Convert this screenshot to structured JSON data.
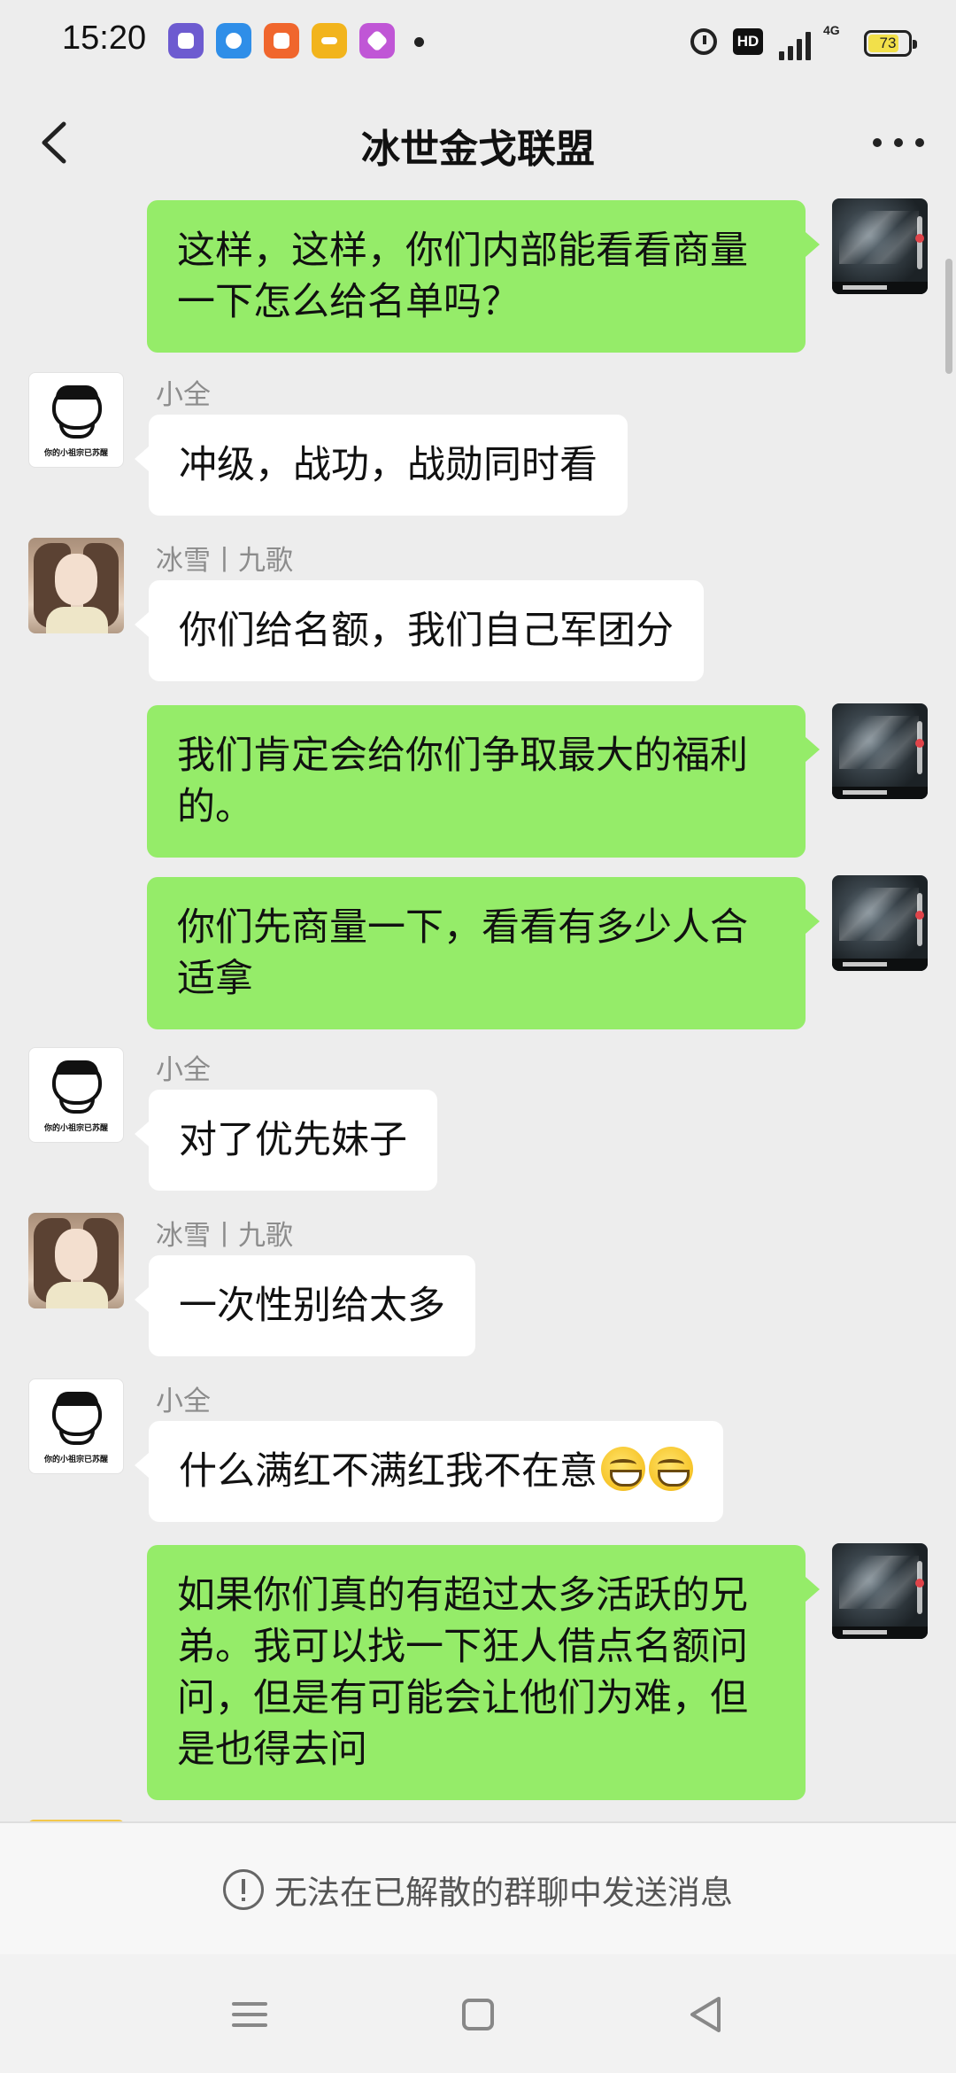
{
  "status_bar": {
    "time": "15:20",
    "app_icons": [
      {
        "name": "app-purple-icon",
        "color": "#6d5bd0"
      },
      {
        "name": "app-blue-icon",
        "color": "#2f8ee8"
      },
      {
        "name": "app-orange-icon",
        "color": "#f0662d"
      },
      {
        "name": "app-wallet-icon",
        "color": "#f2b41c"
      },
      {
        "name": "app-gradient-icon",
        "color": "#c056d6"
      }
    ],
    "hd": "HD",
    "network": "4G",
    "battery": "73"
  },
  "header": {
    "title": "冰世金戈联盟"
  },
  "messages": [
    {
      "side": "out",
      "lines": [
        "这样，这样，你们内部能看看商量",
        "一下怎么给名单吗？"
      ]
    },
    {
      "side": "in",
      "sender": "小全",
      "avatar": "doodle",
      "lines": [
        "冲级，战功，战勋同时看"
      ]
    },
    {
      "side": "in",
      "sender": "冰雪丨九歌",
      "avatar": "photo",
      "lines": [
        "你们给名额，我们自己军团分"
      ]
    },
    {
      "side": "out",
      "lines": [
        "我们肯定会给你们争取最大的福利",
        "的。"
      ]
    },
    {
      "side": "out",
      "lines": [
        "你们先商量一下，看看有多少人合",
        "适拿"
      ]
    },
    {
      "side": "in",
      "sender": "小全",
      "avatar": "doodle",
      "lines": [
        "对了优先妹子"
      ]
    },
    {
      "side": "in",
      "sender": "冰雪丨九歌",
      "avatar": "photo",
      "lines": [
        "一次性别给太多"
      ]
    },
    {
      "side": "in",
      "sender": "小全",
      "avatar": "doodle",
      "lines": [
        "什么满红不满红我不在意"
      ],
      "emoji_count": 2
    },
    {
      "side": "out",
      "lines": [
        "如果你们真的有超过太多活跃的兄",
        "弟。我可以找一下狂人借点名额问",
        "问，但是有可能会让他们为难，但",
        "是也得去问"
      ]
    }
  ],
  "avatar_captions": {
    "doodle": "你的小祖宗已苏醒"
  },
  "footer": {
    "notice": "无法在已解散的群聊中发送消息"
  },
  "colors": {
    "background": "#ededed",
    "outgoing_bubble": "#95ec69",
    "incoming_bubble": "#ffffff",
    "sender_name": "#8c8c8c"
  }
}
